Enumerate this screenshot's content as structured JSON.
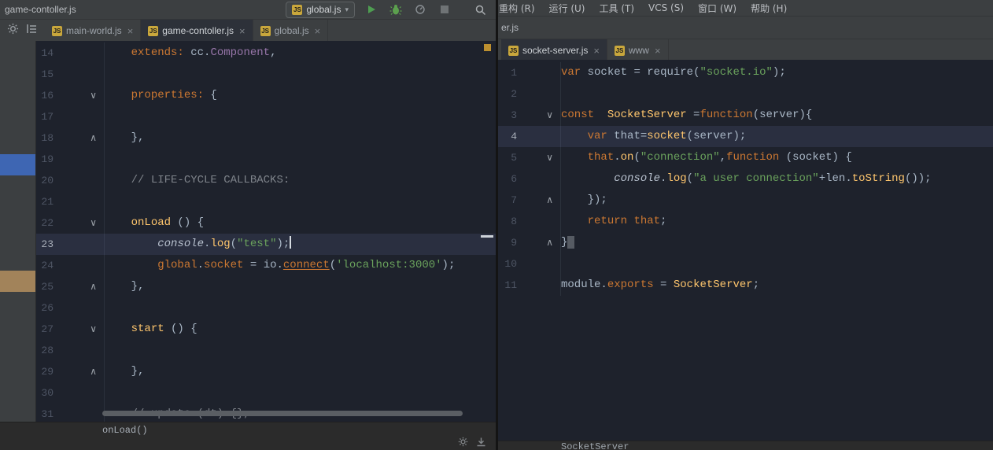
{
  "left_window": {
    "title": "game-contoller.js",
    "toolbar": {
      "run_config_label": "global.js"
    },
    "tabs": [
      {
        "label": "main-world.js",
        "active": false
      },
      {
        "label": "game-contoller.js",
        "active": true
      },
      {
        "label": "global.js",
        "active": false
      }
    ],
    "breadcrumb": "onLoad()",
    "editor": {
      "current_line": 23,
      "lines": [
        {
          "n": 14,
          "fold": "",
          "tokens": [
            [
              "    ",
              "d"
            ],
            [
              "extends:",
              "k"
            ],
            [
              " ",
              "d"
            ],
            [
              "cc",
              "d"
            ],
            [
              ".",
              "d"
            ],
            [
              "Component",
              "p"
            ],
            [
              ",",
              "d"
            ]
          ]
        },
        {
          "n": 15,
          "fold": "",
          "tokens": []
        },
        {
          "n": 16,
          "fold": "open",
          "tokens": [
            [
              "    ",
              "d"
            ],
            [
              "properties:",
              "k"
            ],
            [
              " {",
              "d"
            ]
          ]
        },
        {
          "n": 17,
          "fold": "",
          "tokens": []
        },
        {
          "n": 18,
          "fold": "close",
          "tokens": [
            [
              "    ",
              "d"
            ],
            [
              "},",
              "d"
            ]
          ]
        },
        {
          "n": 19,
          "fold": "",
          "tokens": []
        },
        {
          "n": 20,
          "fold": "",
          "tokens": [
            [
              "    ",
              "d"
            ],
            [
              "// LIFE-CYCLE CALLBACKS:",
              "c"
            ]
          ]
        },
        {
          "n": 21,
          "fold": "",
          "tokens": []
        },
        {
          "n": 22,
          "fold": "open",
          "tokens": [
            [
              "    ",
              "d"
            ],
            [
              "onLoad",
              "y"
            ],
            [
              " () {",
              "d"
            ]
          ]
        },
        {
          "n": 23,
          "fold": "",
          "caret": true,
          "tokens": [
            [
              "        ",
              "d"
            ],
            [
              "console",
              "i"
            ],
            [
              ".",
              "d"
            ],
            [
              "log",
              "y"
            ],
            [
              "(",
              "d"
            ],
            [
              "\"test\"",
              "s"
            ],
            [
              ")",
              "d"
            ],
            [
              ";",
              "d"
            ]
          ]
        },
        {
          "n": 24,
          "fold": "",
          "tokens": [
            [
              "        ",
              "d"
            ],
            [
              "global",
              "k"
            ],
            [
              ".",
              "d"
            ],
            [
              "socket",
              "k"
            ],
            [
              " = ",
              "d"
            ],
            [
              "io",
              "d"
            ],
            [
              ".",
              "d"
            ],
            [
              "connect",
              "ku"
            ],
            [
              "(",
              "d"
            ],
            [
              "'localhost:3000'",
              "s"
            ],
            [
              ")",
              "d"
            ],
            [
              ";",
              "d"
            ]
          ]
        },
        {
          "n": 25,
          "fold": "close",
          "tokens": [
            [
              "    ",
              "d"
            ],
            [
              "},",
              "d"
            ]
          ]
        },
        {
          "n": 26,
          "fold": "",
          "tokens": []
        },
        {
          "n": 27,
          "fold": "open",
          "tokens": [
            [
              "    ",
              "d"
            ],
            [
              "start",
              "y"
            ],
            [
              " () {",
              "d"
            ]
          ]
        },
        {
          "n": 28,
          "fold": "",
          "tokens": []
        },
        {
          "n": 29,
          "fold": "close",
          "tokens": [
            [
              "    ",
              "d"
            ],
            [
              "},",
              "d"
            ]
          ]
        },
        {
          "n": 30,
          "fold": "",
          "tokens": []
        },
        {
          "n": 31,
          "fold": "",
          "tokens": [
            [
              "    ",
              "d"
            ],
            [
              "// update (dt) {},",
              "c"
            ]
          ]
        }
      ]
    }
  },
  "right_window": {
    "menu_items": [
      "重构 (R)",
      "运行 (U)",
      "工具 (T)",
      "VCS (S)",
      "窗口 (W)",
      "帮助 (H)"
    ],
    "partial_title": "er.js",
    "tabs": [
      {
        "label": "socket-server.js",
        "active": true
      },
      {
        "label": "www",
        "active": false
      }
    ],
    "status_text": "SocketServer",
    "editor": {
      "current_line": 4,
      "lines": [
        {
          "n": 1,
          "fold": "",
          "tokens": [
            [
              "var",
              "k"
            ],
            [
              " ",
              "d"
            ],
            [
              "socket",
              "d"
            ],
            [
              " = ",
              "d"
            ],
            [
              "require",
              "d"
            ],
            [
              "(",
              "d"
            ],
            [
              "\"socket.io\"",
              "s"
            ],
            [
              ")",
              "d"
            ],
            [
              ";",
              "d"
            ]
          ]
        },
        {
          "n": 2,
          "fold": "",
          "tokens": []
        },
        {
          "n": 3,
          "fold": "open",
          "tokens": [
            [
              "const",
              "k"
            ],
            [
              "  ",
              "d"
            ],
            [
              "SocketServer",
              "y"
            ],
            [
              " =",
              "d"
            ],
            [
              "function",
              "k"
            ],
            [
              "(",
              "d"
            ],
            [
              "server",
              "d"
            ],
            [
              "){",
              "d"
            ]
          ]
        },
        {
          "n": 4,
          "fold": "",
          "tokens": [
            [
              "    ",
              "d"
            ],
            [
              "var",
              "k"
            ],
            [
              " ",
              "d"
            ],
            [
              "that",
              "d"
            ],
            [
              "=",
              "d"
            ],
            [
              "socket",
              "y"
            ],
            [
              "(",
              "d"
            ],
            [
              "server",
              "d"
            ],
            [
              ");",
              "d"
            ]
          ]
        },
        {
          "n": 5,
          "fold": "open",
          "tokens": [
            [
              "    ",
              "d"
            ],
            [
              "that",
              "k"
            ],
            [
              ".",
              "d"
            ],
            [
              "on",
              "y"
            ],
            [
              "(",
              "d"
            ],
            [
              "\"connection\"",
              "s"
            ],
            [
              ",",
              "d"
            ],
            [
              "function",
              "k"
            ],
            [
              " (",
              "d"
            ],
            [
              "socket",
              "d"
            ],
            [
              ") {",
              "d"
            ]
          ]
        },
        {
          "n": 6,
          "fold": "",
          "tokens": [
            [
              "        ",
              "d"
            ],
            [
              "console",
              "i"
            ],
            [
              ".",
              "d"
            ],
            [
              "log",
              "y"
            ],
            [
              "(",
              "d"
            ],
            [
              "\"a user connection\"",
              "s"
            ],
            [
              "+",
              "d"
            ],
            [
              "len",
              "d"
            ],
            [
              ".",
              "d"
            ],
            [
              "toString",
              "y"
            ],
            [
              "()",
              "d"
            ],
            [
              ");",
              "d"
            ]
          ]
        },
        {
          "n": 7,
          "fold": "close",
          "tokens": [
            [
              "    ",
              "d"
            ],
            [
              "});",
              "d"
            ]
          ]
        },
        {
          "n": 8,
          "fold": "",
          "tokens": [
            [
              "    ",
              "d"
            ],
            [
              "return",
              "k"
            ],
            [
              " ",
              "d"
            ],
            [
              "that",
              "k"
            ],
            [
              ";",
              "d"
            ]
          ]
        },
        {
          "n": 9,
          "fold": "close",
          "tokens": [
            [
              "}",
              "d"
            ],
            [
              " ",
              "bc"
            ]
          ]
        },
        {
          "n": 10,
          "fold": "",
          "tokens": []
        },
        {
          "n": 11,
          "fold": "",
          "tokens": [
            [
              "module",
              "d"
            ],
            [
              ".",
              "d"
            ],
            [
              "exports",
              "k"
            ],
            [
              " = ",
              "d"
            ],
            [
              "SocketServer",
              "y"
            ],
            [
              ";",
              "d"
            ]
          ]
        }
      ]
    }
  },
  "icons": {
    "run": "green-triangle",
    "debug": "green-bug",
    "stop": "gray-square",
    "search": "magnifier",
    "settings": "gear",
    "file_type": "JS"
  },
  "colors": {
    "chrome_bg": "#3C3F41",
    "editor_bg": "#1E222C",
    "current_line_bg": "#2A2F40",
    "keyword": "#CC7832",
    "function_name": "#FFC66D",
    "string": "#6AA25C",
    "comment": "#7F848B",
    "class_ref": "#9876AA",
    "default_text": "#A9B7C6",
    "run_green": "#4E9D51",
    "selection_blue": "#3E66B3",
    "selection_tan": "#A2835A"
  }
}
